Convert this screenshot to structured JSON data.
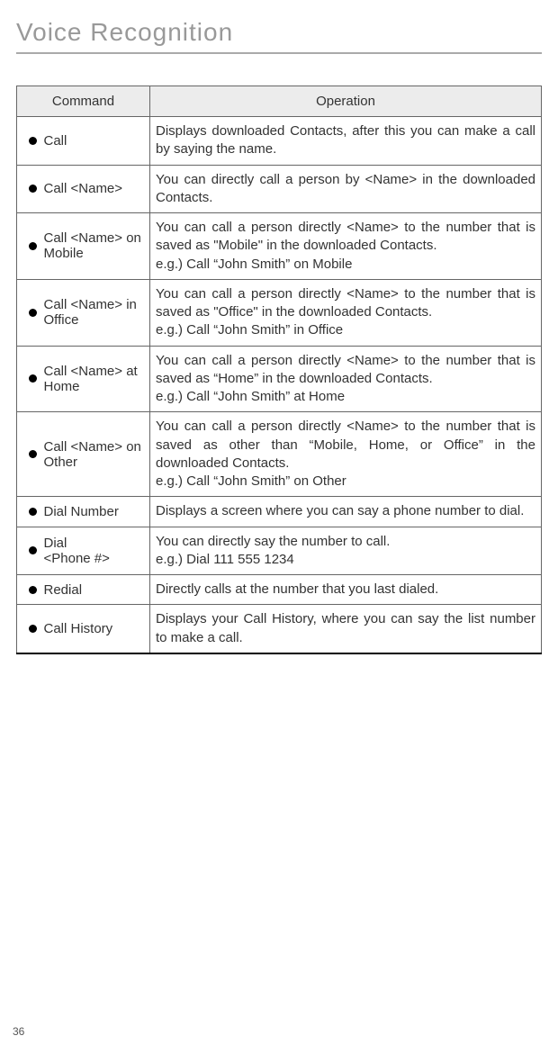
{
  "title": "Voice Recognition",
  "table": {
    "headers": {
      "command": "Command",
      "operation": "Operation"
    },
    "rows": [
      {
        "command": "Call",
        "operation": "Displays downloaded Contacts, after this you can make a call by saying the name."
      },
      {
        "command": "Call <Name>",
        "operation": "You can directly call a person by <Name> in the downloaded Contacts."
      },
      {
        "command": "Call <Name> on Mobile",
        "operation": "You can call a person directly <Name> to the number that is saved as \"Mobile\" in the downloaded Contacts.\ne.g.) Call “John Smith” on Mobile"
      },
      {
        "command": "Call <Name> in Office",
        "operation": "You can call a person directly <Name> to the number that is saved as \"Office\" in the downloaded Contacts.\ne.g.) Call “John Smith” in Office"
      },
      {
        "command": "Call <Name> at Home",
        "operation": "You can call a person directly <Name> to the number that is saved as “Home” in the downloaded Contacts.\ne.g.) Call “John Smith” at Home"
      },
      {
        "command": "Call <Name> on Other",
        "operation": "You can call a person directly <Name> to the number that is saved as other than “Mobile, Home, or Office” in the downloaded Contacts.\ne.g.) Call “John Smith” on Other"
      },
      {
        "command": "Dial Number",
        "operation": "Displays a screen where you can say a phone number to dial."
      },
      {
        "command": "Dial\n<Phone #>",
        "operation": "You can directly say the number to call.\ne.g.) Dial 111 555 1234"
      },
      {
        "command": "Redial",
        "operation": "Directly calls at the number that you last dialed."
      },
      {
        "command": "Call History",
        "operation": "Displays your Call History, where you can say the list number to make a call."
      }
    ]
  },
  "pageNumber": "36"
}
